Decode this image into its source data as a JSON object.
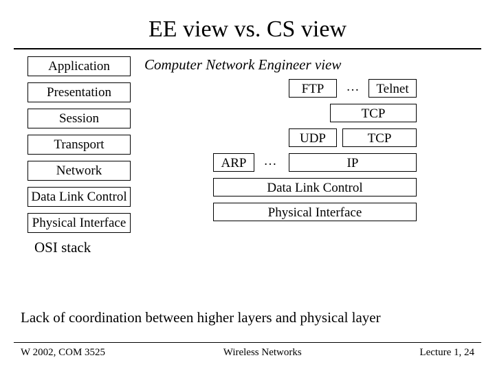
{
  "title": "EE view vs. CS view",
  "osi": {
    "layers": [
      "Application",
      "Presentation",
      "Session",
      "Transport",
      "Network",
      "Data Link Control",
      "Physical Interface"
    ],
    "label": "OSI stack"
  },
  "cne": {
    "title": "Computer Network Engineer view",
    "row_apps": {
      "ftp": "FTP",
      "dots": "…",
      "telnet": "Telnet"
    },
    "row_tcp_wide": "TCP",
    "row_transport": {
      "udp": "UDP",
      "tcp": "TCP"
    },
    "row_network": {
      "arp": "ARP",
      "dots": "…",
      "ip": "IP"
    },
    "row_dlc": "Data Link Control",
    "row_phy": "Physical Interface"
  },
  "body_text": "Lack of coordination between higher layers and physical layer",
  "footer": {
    "left": "W 2002, COM 3525",
    "center": "Wireless Networks",
    "right": "Lecture 1, 24"
  },
  "chart_data": {
    "type": "table",
    "title": "EE view vs. CS view",
    "left_stack_label": "OSI stack",
    "left_stack": [
      "Application",
      "Presentation",
      "Session",
      "Transport",
      "Network",
      "Data Link Control",
      "Physical Interface"
    ],
    "right_stack_label": "Computer Network Engineer view",
    "right_rows": [
      [
        "FTP",
        "…",
        "Telnet"
      ],
      [
        "TCP"
      ],
      [
        "UDP",
        "TCP"
      ],
      [
        "ARP",
        "…",
        "IP"
      ],
      [
        "Data Link Control"
      ],
      [
        "Physical Interface"
      ]
    ]
  }
}
